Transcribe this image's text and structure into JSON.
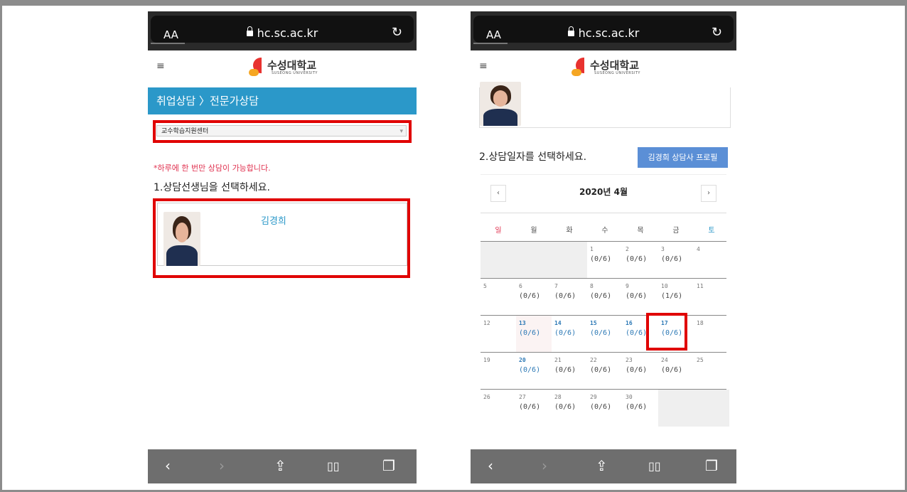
{
  "left_screen": {
    "browser": {
      "text_size": "AA",
      "url": "hc.sc.ac.kr"
    },
    "logo": {
      "name": "수성대학교",
      "sub": "SUSEONG UNIVERSITY"
    },
    "page_title": "취업상담 〉전문가상담",
    "select": {
      "value": "교수학습지원센터"
    },
    "notice": "*하루에 한 번만 상담이 가능합니다.",
    "step1": "1.상담선생님을 선택하세요.",
    "counselor": {
      "name": "김경희"
    }
  },
  "right_screen": {
    "browser": {
      "text_size": "AA",
      "url": "hc.sc.ac.kr"
    },
    "logo": {
      "name": "수성대학교",
      "sub": "SUSEONG UNIVERSITY"
    },
    "step2": "2.상담일자를 선택하세요.",
    "profile_button": "김경희 상담사 프로필",
    "calendar": {
      "prev": "‹",
      "next": "›",
      "month": "2020년 4월",
      "weekdays": [
        "일",
        "월",
        "화",
        "수",
        "목",
        "금",
        "토"
      ],
      "weeks": [
        [
          {
            "d": "",
            "c": ""
          },
          {
            "d": "",
            "c": ""
          },
          {
            "d": "",
            "c": ""
          },
          {
            "d": "1",
            "c": "(0/6)"
          },
          {
            "d": "2",
            "c": "(0/6)"
          },
          {
            "d": "3",
            "c": "(0/6)"
          },
          {
            "d": "4",
            "c": ""
          }
        ],
        [
          {
            "d": "5",
            "c": ""
          },
          {
            "d": "6",
            "c": "(0/6)"
          },
          {
            "d": "7",
            "c": "(0/6)"
          },
          {
            "d": "8",
            "c": "(0/6)"
          },
          {
            "d": "9",
            "c": "(0/6)"
          },
          {
            "d": "10",
            "c": "(1/6)"
          },
          {
            "d": "11",
            "c": ""
          }
        ],
        [
          {
            "d": "12",
            "c": ""
          },
          {
            "d": "13",
            "c": "(0/6)"
          },
          {
            "d": "14",
            "c": "(0/6)"
          },
          {
            "d": "15",
            "c": "(0/6)"
          },
          {
            "d": "16",
            "c": "(0/6)"
          },
          {
            "d": "17",
            "c": "(0/6)"
          },
          {
            "d": "18",
            "c": ""
          }
        ],
        [
          {
            "d": "19",
            "c": ""
          },
          {
            "d": "20",
            "c": "(0/6)"
          },
          {
            "d": "21",
            "c": "(0/6)"
          },
          {
            "d": "22",
            "c": "(0/6)"
          },
          {
            "d": "23",
            "c": "(0/6)"
          },
          {
            "d": "24",
            "c": "(0/6)"
          },
          {
            "d": "25",
            "c": ""
          }
        ],
        [
          {
            "d": "26",
            "c": ""
          },
          {
            "d": "27",
            "c": "(0/6)"
          },
          {
            "d": "28",
            "c": "(0/6)"
          },
          {
            "d": "29",
            "c": "(0/6)"
          },
          {
            "d": "30",
            "c": "(0/6)"
          },
          {
            "d": "",
            "c": ""
          },
          {
            "d": "",
            "c": ""
          }
        ]
      ]
    }
  },
  "toolbar": {
    "back": "‹",
    "forward": "›",
    "share": "⇪",
    "bookmarks": "📖",
    "tabs": "❐"
  },
  "colors": {
    "accent": "#2b98c9",
    "highlight_box": "#e00000",
    "notice": "#e0314f",
    "button": "#5b8fd6"
  }
}
